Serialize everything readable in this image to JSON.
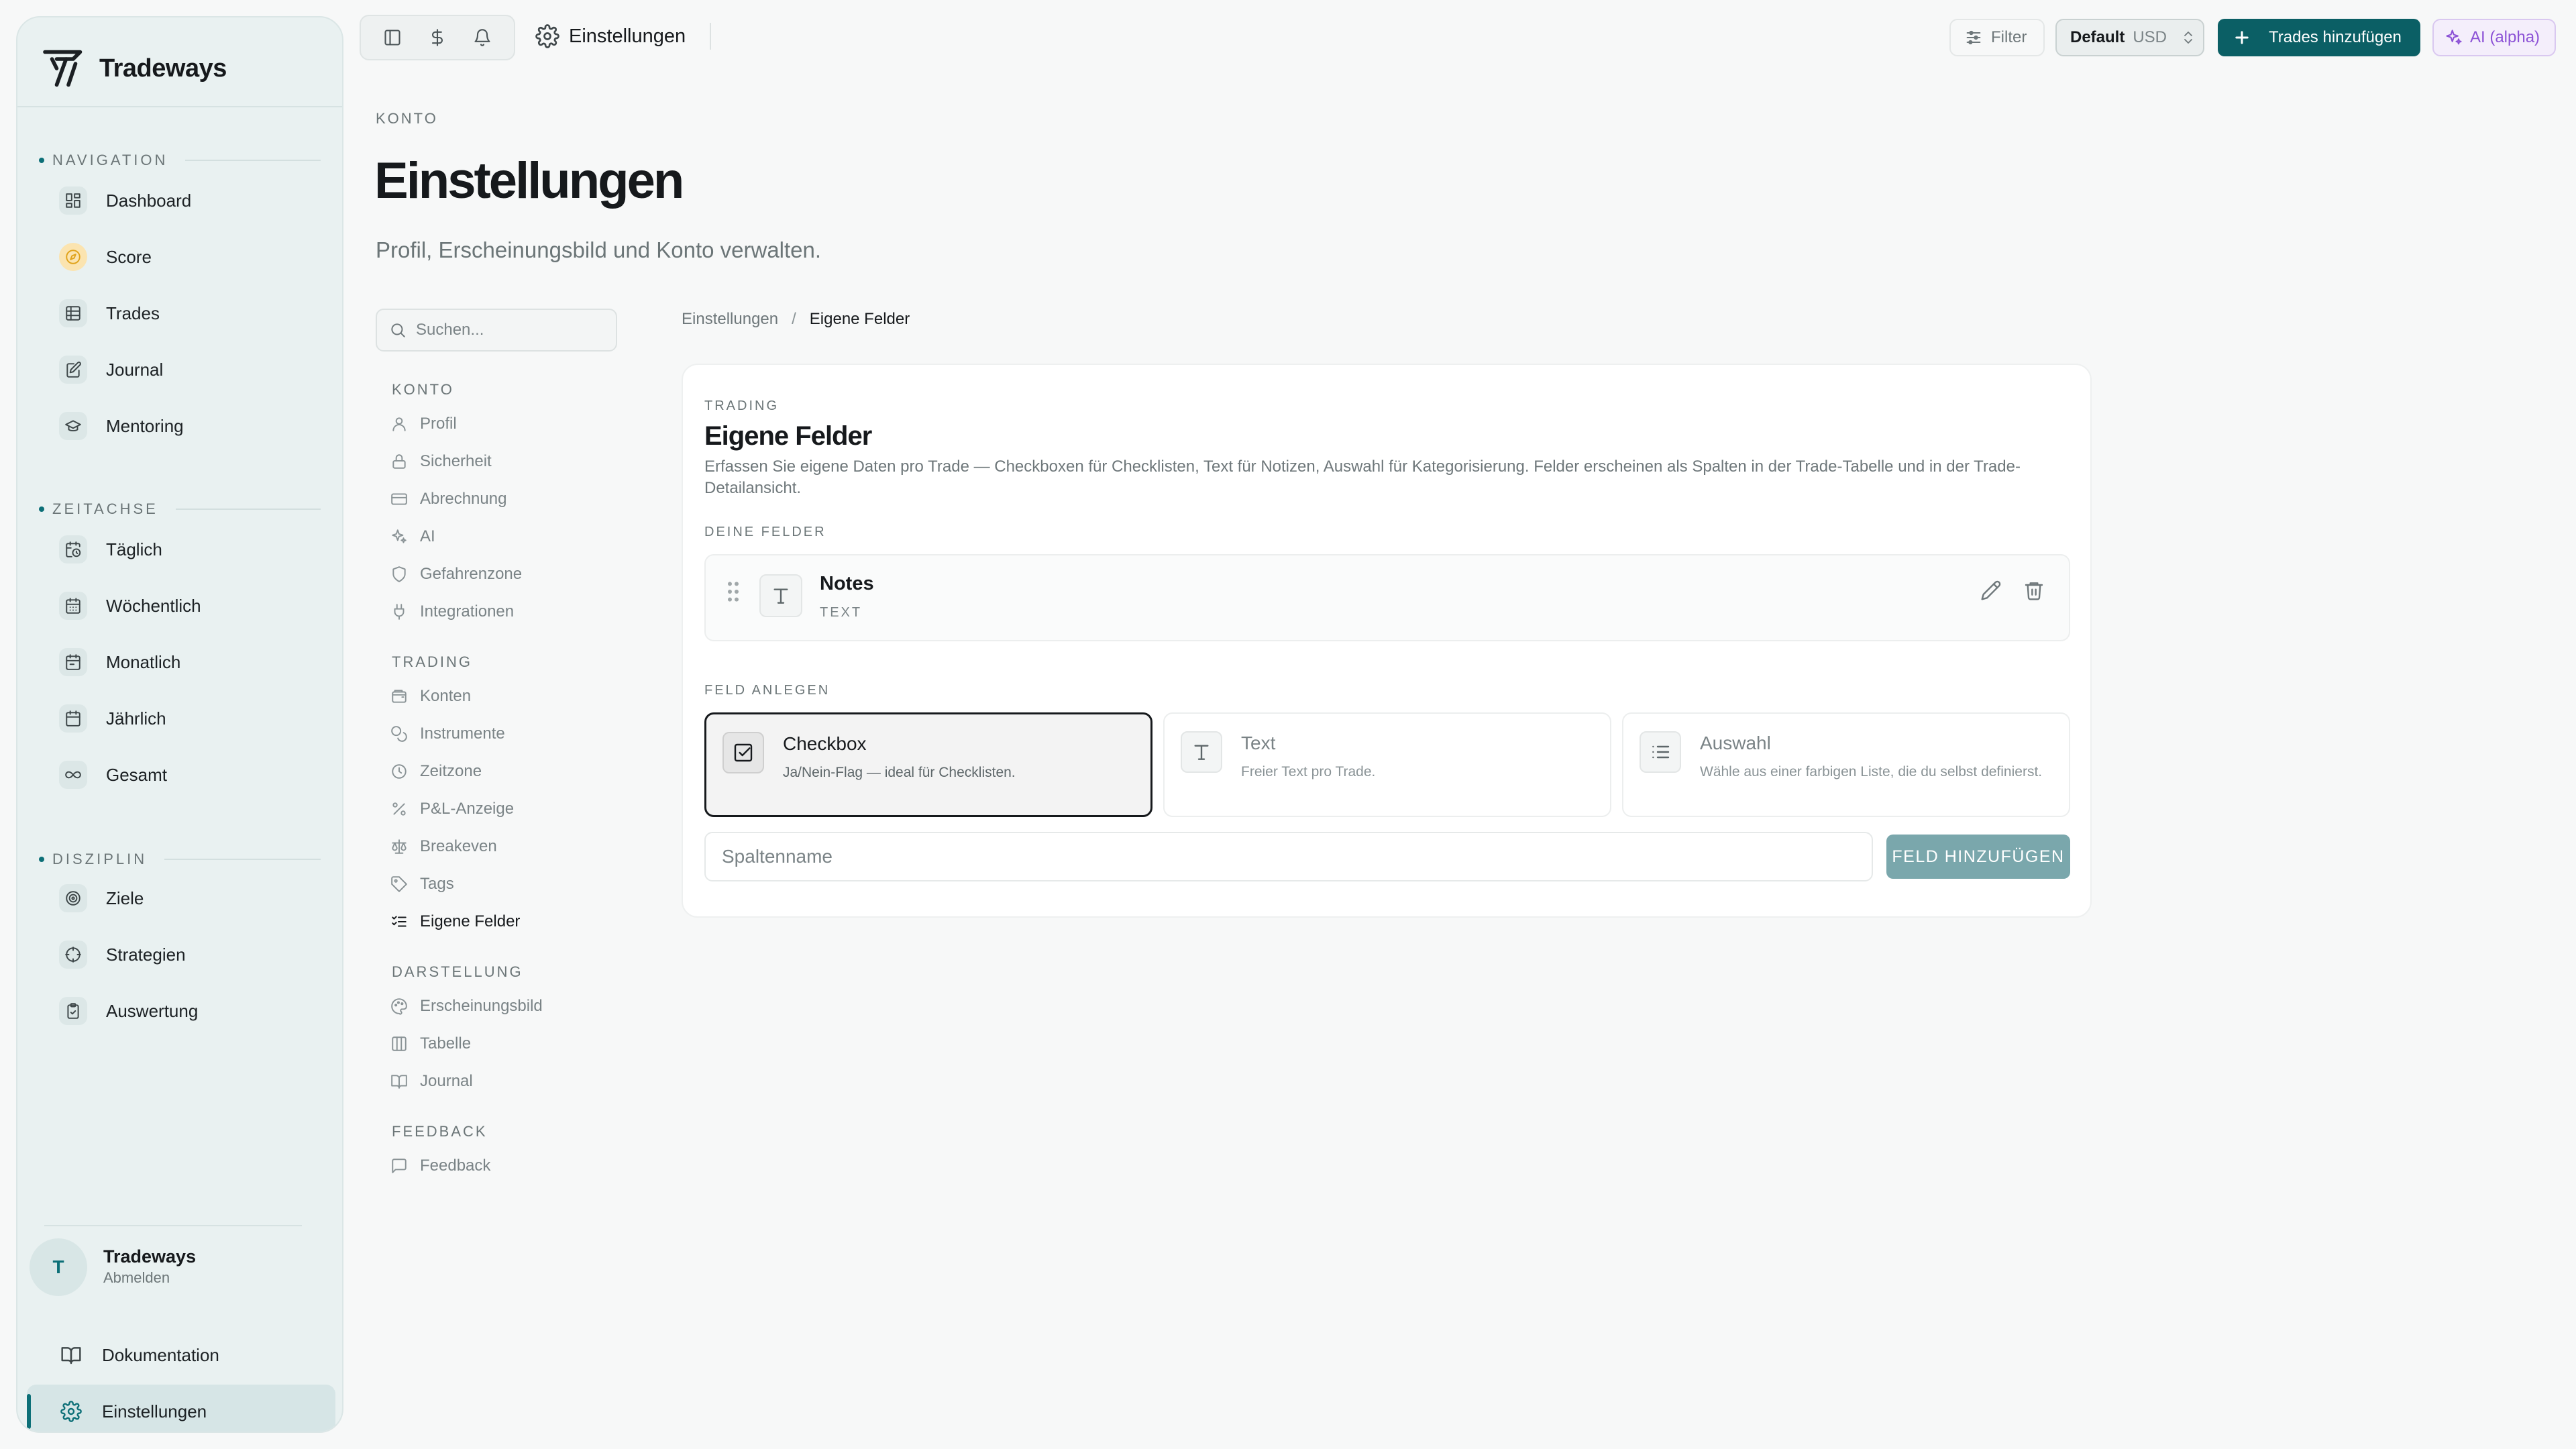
{
  "app": {
    "brand": "Tradeways"
  },
  "sidebar": {
    "sections": [
      {
        "label": "NAVIGATION",
        "items": [
          {
            "label": "Dashboard",
            "icon": "dashboard-icon"
          },
          {
            "label": "Score",
            "icon": "compass-icon"
          },
          {
            "label": "Trades",
            "icon": "table-icon"
          },
          {
            "label": "Journal",
            "icon": "journal-icon"
          },
          {
            "label": "Mentoring",
            "icon": "graduation-cap-icon"
          }
        ]
      },
      {
        "label": "ZEITACHSE",
        "items": [
          {
            "label": "Täglich",
            "icon": "calendar-clock-icon"
          },
          {
            "label": "Wöchentlich",
            "icon": "calendar-week-icon"
          },
          {
            "label": "Monatlich",
            "icon": "calendar-month-icon"
          },
          {
            "label": "Jährlich",
            "icon": "calendar-icon"
          },
          {
            "label": "Gesamt",
            "icon": "infinity-icon"
          }
        ]
      },
      {
        "label": "DISZIPLIN",
        "items": [
          {
            "label": "Ziele",
            "icon": "target-icon"
          },
          {
            "label": "Strategien",
            "icon": "crosshair-icon"
          },
          {
            "label": "Auswertung",
            "icon": "clipboard-check-icon"
          }
        ]
      }
    ],
    "user": {
      "initial": "T",
      "name": "Tradeways",
      "action": "Abmelden"
    },
    "bottom": [
      {
        "label": "Dokumentation",
        "icon": "book-icon"
      },
      {
        "label": "Einstellungen",
        "icon": "gear-icon",
        "active": true
      }
    ]
  },
  "topbar": {
    "page_title": "Einstellungen",
    "filter_label": "Filter",
    "account": {
      "name": "Default",
      "currency": "USD"
    },
    "add_trades_label": "Trades hinzufügen",
    "ai_label": "AI (alpha)"
  },
  "header": {
    "eyebrow": "KONTO",
    "title": "Einstellungen",
    "subtitle": "Profil, Erscheinungsbild und Konto verwalten."
  },
  "settings_nav": {
    "search_placeholder": "Suchen...",
    "groups": [
      {
        "label": "KONTO",
        "items": [
          {
            "label": "Profil",
            "icon": "user-icon"
          },
          {
            "label": "Sicherheit",
            "icon": "lock-icon"
          },
          {
            "label": "Abrechnung",
            "icon": "credit-card-icon"
          },
          {
            "label": "AI",
            "icon": "sparkles-icon"
          },
          {
            "label": "Gefahrenzone",
            "icon": "shield-icon"
          },
          {
            "label": "Integrationen",
            "icon": "plug-icon"
          }
        ]
      },
      {
        "label": "TRADING",
        "items": [
          {
            "label": "Konten",
            "icon": "wallet-icon"
          },
          {
            "label": "Instrumente",
            "icon": "coins-icon"
          },
          {
            "label": "Zeitzone",
            "icon": "clock-icon"
          },
          {
            "label": "P&L-Anzeige",
            "icon": "percent-icon"
          },
          {
            "label": "Breakeven",
            "icon": "scale-icon"
          },
          {
            "label": "Tags",
            "icon": "tag-icon"
          },
          {
            "label": "Eigene Felder",
            "icon": "list-checks-icon",
            "active": true
          }
        ]
      },
      {
        "label": "DARSTELLUNG",
        "items": [
          {
            "label": "Erscheinungsbild",
            "icon": "palette-icon"
          },
          {
            "label": "Tabelle",
            "icon": "columns-icon"
          },
          {
            "label": "Journal",
            "icon": "book-open-icon"
          }
        ]
      },
      {
        "label": "FEEDBACK",
        "items": [
          {
            "label": "Feedback",
            "icon": "message-icon"
          }
        ]
      }
    ]
  },
  "breadcrumb": {
    "parent": "Einstellungen",
    "separator": "/",
    "current": "Eigene Felder"
  },
  "card": {
    "eyebrow": "TRADING",
    "title": "Eigene Felder",
    "description": "Erfassen Sie eigene Daten pro Trade — Checkboxen für Checklisten, Text für Notizen, Auswahl für Kategorisierung. Felder erscheinen als Spalten in der Trade-Tabelle und in der Trade-Detailansicht.",
    "your_fields_label": "DEINE FELDER",
    "fields": [
      {
        "name": "Notes",
        "type": "TEXT"
      }
    ],
    "create_label": "FELD ANLEGEN",
    "types": [
      {
        "title": "Checkbox",
        "desc": "Ja/Nein-Flag — ideal für Checklisten.",
        "selected": true
      },
      {
        "title": "Text",
        "desc": "Freier Text pro Trade.",
        "selected": false
      },
      {
        "title": "Auswahl",
        "desc": "Wähle aus einer farbigen Liste, die du selbst definierst.",
        "selected": false
      }
    ],
    "column_placeholder": "Spaltenname",
    "add_button": "FELD HINZUFÜGEN"
  },
  "colors": {
    "accent": "#0b5f65",
    "sidebar_bg": "#e9f1f1",
    "ai": "#8c52d6",
    "score": "#e0a31b"
  }
}
